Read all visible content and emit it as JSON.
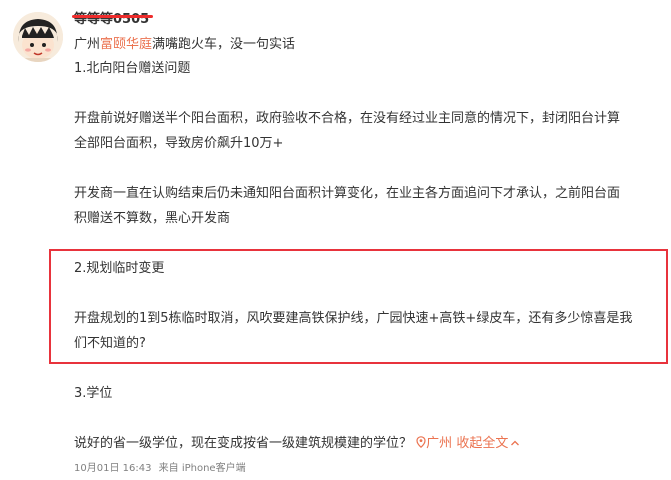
{
  "post": {
    "username": "等等等0505",
    "headline_prefix": "广州",
    "headline_link": "富颐华庭",
    "headline_suffix": "满嘴跑火车，没一句实话",
    "section1_title": "1.北向阳台赠送问题",
    "para1_line1": "开盘前说好赠送半个阳台面积，政府验收不合格，在没有经过业主同意的情况下，封闭阳台计算",
    "para1_line2": "全部阳台面积，导致房价飙升10万+",
    "para2_line1": "开发商一直在认购结束后仍未通知阳台面积计算变化，在业主各方面追问下才承认，之前阳台面",
    "para2_line2": "积赠送不算数，黑心开发商",
    "section2_title": "2.规划临时变更",
    "para3_line1": "开盘规划的1到5栋临时取消，风吹要建高铁保护线，广园快速+高铁+绿皮车，还有多少惊喜是我",
    "para3_line2": "们不知道的?",
    "section3_title": "3.学位",
    "para4": "说好的省一级学位，现在变成按省一级建筑规模建的学位？",
    "location": "广州",
    "collapse_label": "收起全文",
    "timestamp": "10月01日 16:43",
    "source": "来自 iPhone客户端"
  },
  "icons": {
    "location": "location-pin-icon",
    "collapse": "chevron-up-icon"
  },
  "colors": {
    "link": "#eb7350",
    "highlight_border": "#e8333c",
    "strike": "#ee2c2c"
  }
}
